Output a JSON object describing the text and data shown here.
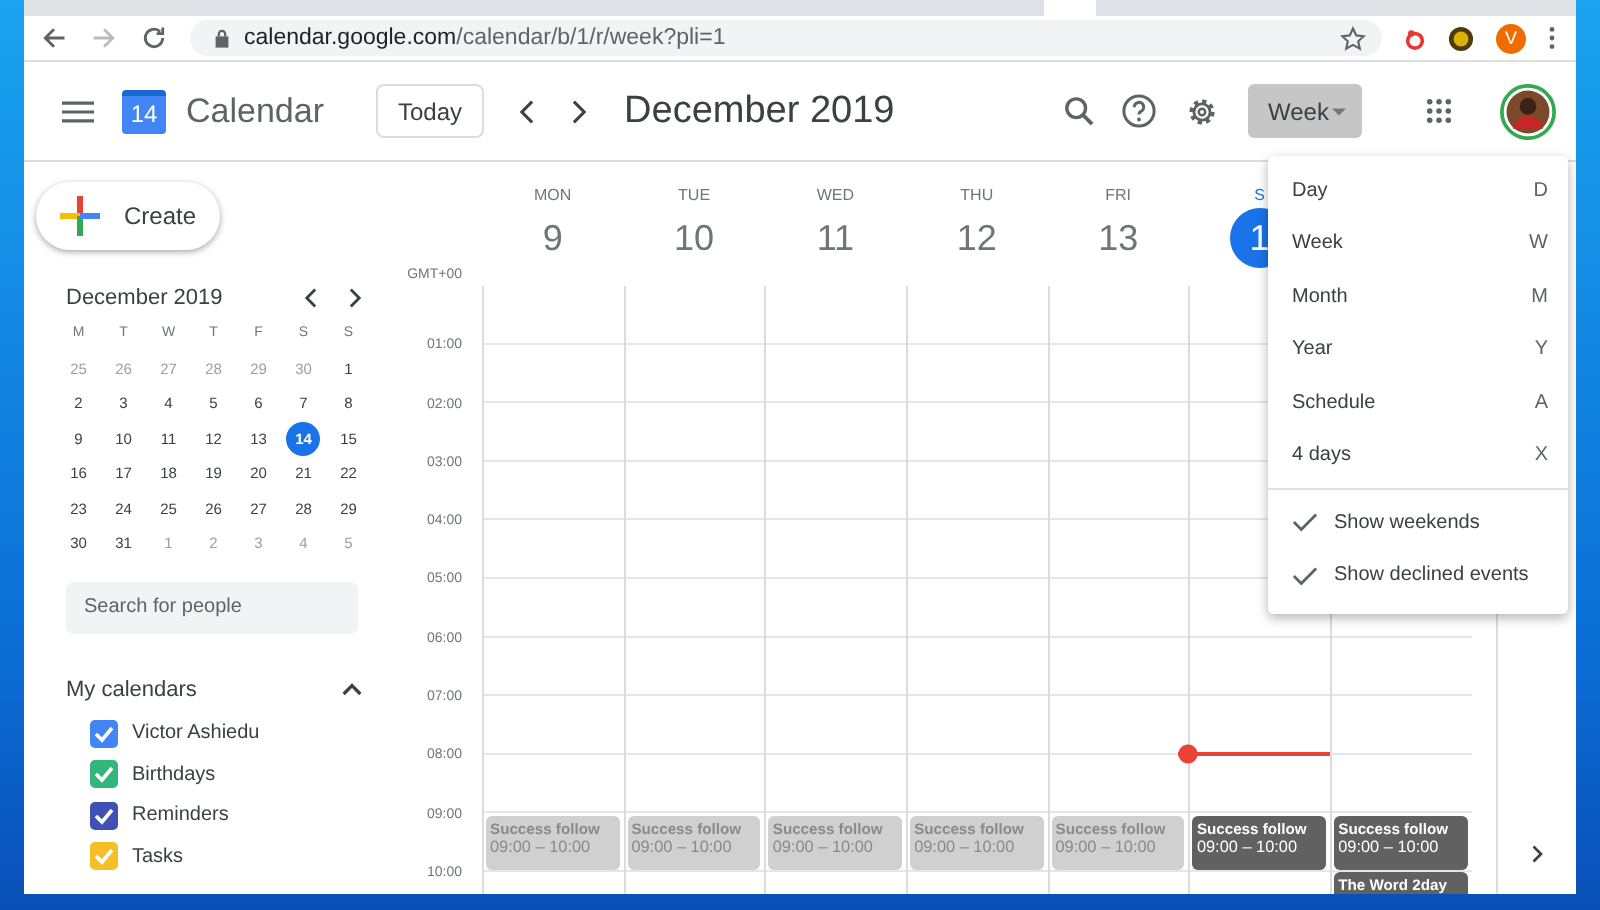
{
  "browser": {
    "url_host": "calendar.google.com",
    "url_path": "/calendar/b/1/r/week?pli=1",
    "profile_initial": "V"
  },
  "header": {
    "title": "Calendar",
    "logo_day": "14",
    "today": "Today",
    "period": "December 2019",
    "view": "Week"
  },
  "sidebar": {
    "create": "Create",
    "mini_calendar": {
      "title": "December 2019",
      "weekdays": [
        "M",
        "T",
        "W",
        "T",
        "F",
        "S",
        "S"
      ],
      "weeks": [
        [
          {
            "day": "25",
            "muted": true,
            "selected": false
          },
          {
            "day": "26",
            "muted": true,
            "selected": false
          },
          {
            "day": "27",
            "muted": true,
            "selected": false
          },
          {
            "day": "28",
            "muted": true,
            "selected": false
          },
          {
            "day": "29",
            "muted": true,
            "selected": false
          },
          {
            "day": "30",
            "muted": true,
            "selected": false
          },
          {
            "day": "1",
            "muted": false,
            "selected": false
          }
        ],
        [
          {
            "day": "2",
            "muted": false,
            "selected": false
          },
          {
            "day": "3",
            "muted": false,
            "selected": false
          },
          {
            "day": "4",
            "muted": false,
            "selected": false
          },
          {
            "day": "5",
            "muted": false,
            "selected": false
          },
          {
            "day": "6",
            "muted": false,
            "selected": false
          },
          {
            "day": "7",
            "muted": false,
            "selected": false
          },
          {
            "day": "8",
            "muted": false,
            "selected": false
          }
        ],
        [
          {
            "day": "9",
            "muted": false,
            "selected": false
          },
          {
            "day": "10",
            "muted": false,
            "selected": false
          },
          {
            "day": "11",
            "muted": false,
            "selected": false
          },
          {
            "day": "12",
            "muted": false,
            "selected": false
          },
          {
            "day": "13",
            "muted": false,
            "selected": false
          },
          {
            "day": "14",
            "muted": false,
            "selected": true
          },
          {
            "day": "15",
            "muted": false,
            "selected": false
          }
        ],
        [
          {
            "day": "16",
            "muted": false,
            "selected": false
          },
          {
            "day": "17",
            "muted": false,
            "selected": false
          },
          {
            "day": "18",
            "muted": false,
            "selected": false
          },
          {
            "day": "19",
            "muted": false,
            "selected": false
          },
          {
            "day": "20",
            "muted": false,
            "selected": false
          },
          {
            "day": "21",
            "muted": false,
            "selected": false
          },
          {
            "day": "22",
            "muted": false,
            "selected": false
          }
        ],
        [
          {
            "day": "23",
            "muted": false,
            "selected": false
          },
          {
            "day": "24",
            "muted": false,
            "selected": false
          },
          {
            "day": "25",
            "muted": false,
            "selected": false
          },
          {
            "day": "26",
            "muted": false,
            "selected": false
          },
          {
            "day": "27",
            "muted": false,
            "selected": false
          },
          {
            "day": "28",
            "muted": false,
            "selected": false
          },
          {
            "day": "29",
            "muted": false,
            "selected": false
          }
        ],
        [
          {
            "day": "30",
            "muted": false,
            "selected": false
          },
          {
            "day": "31",
            "muted": false,
            "selected": false
          },
          {
            "day": "1",
            "muted": true,
            "selected": false
          },
          {
            "day": "2",
            "muted": true,
            "selected": false
          },
          {
            "day": "3",
            "muted": true,
            "selected": false
          },
          {
            "day": "4",
            "muted": true,
            "selected": false
          },
          {
            "day": "5",
            "muted": true,
            "selected": false
          }
        ]
      ]
    },
    "search_placeholder": "Search for people",
    "my_calendars": {
      "title": "My calendars",
      "expanded": true,
      "items": [
        {
          "name": "Victor Ashiedu",
          "checked": true,
          "color": "#4285f4"
        },
        {
          "name": "Birthdays",
          "checked": true,
          "color": "#33b679"
        },
        {
          "name": "Reminders",
          "checked": true,
          "color": "#3f51b5"
        },
        {
          "name": "Tasks",
          "checked": true,
          "color": "#f6bf26"
        }
      ]
    }
  },
  "week": {
    "timezone": "GMT+00",
    "hours": [
      "01:00",
      "02:00",
      "03:00",
      "04:00",
      "05:00",
      "06:00",
      "07:00",
      "08:00",
      "09:00",
      "10:00"
    ],
    "days": [
      {
        "weekday": "MON",
        "date": "9",
        "selected": false,
        "now": false,
        "events": [
          {
            "title": "Success follow",
            "time": "09:00 – 10:00",
            "past": true
          }
        ]
      },
      {
        "weekday": "TUE",
        "date": "10",
        "selected": false,
        "now": false,
        "events": [
          {
            "title": "Success follow",
            "time": "09:00 – 10:00",
            "past": true
          }
        ]
      },
      {
        "weekday": "WED",
        "date": "11",
        "selected": false,
        "now": false,
        "events": [
          {
            "title": "Success follow",
            "time": "09:00 – 10:00",
            "past": true
          }
        ]
      },
      {
        "weekday": "THU",
        "date": "12",
        "selected": false,
        "now": false,
        "events": [
          {
            "title": "Success follow",
            "time": "09:00 – 10:00",
            "past": true
          }
        ]
      },
      {
        "weekday": "FRI",
        "date": "13",
        "selected": false,
        "now": false,
        "events": [
          {
            "title": "Success follow",
            "time": "09:00 – 10:00",
            "past": true
          }
        ]
      },
      {
        "weekday": "S",
        "date": "1",
        "selected": true,
        "now": true,
        "events": [
          {
            "title": "Success follow",
            "time": "09:00 – 10:00",
            "past": false
          }
        ]
      },
      {
        "now": false,
        "events": [
          {
            "title": "Success follow",
            "time": "09:00 – 10:00",
            "past": false
          },
          {
            "title": "The Word 2day",
            "past": false
          }
        ]
      }
    ]
  },
  "view_menu": {
    "open": true,
    "items": [
      {
        "label": "Day",
        "shortcut": "D"
      },
      {
        "label": "Week",
        "shortcut": "W"
      },
      {
        "label": "Month",
        "shortcut": "M"
      },
      {
        "label": "Year",
        "shortcut": "Y"
      },
      {
        "label": "Schedule",
        "shortcut": "A"
      },
      {
        "label": "4 days",
        "shortcut": "X"
      }
    ],
    "options": [
      {
        "label": "Show weekends",
        "checked": true
      },
      {
        "label": "Show declined events",
        "checked": true
      }
    ]
  }
}
